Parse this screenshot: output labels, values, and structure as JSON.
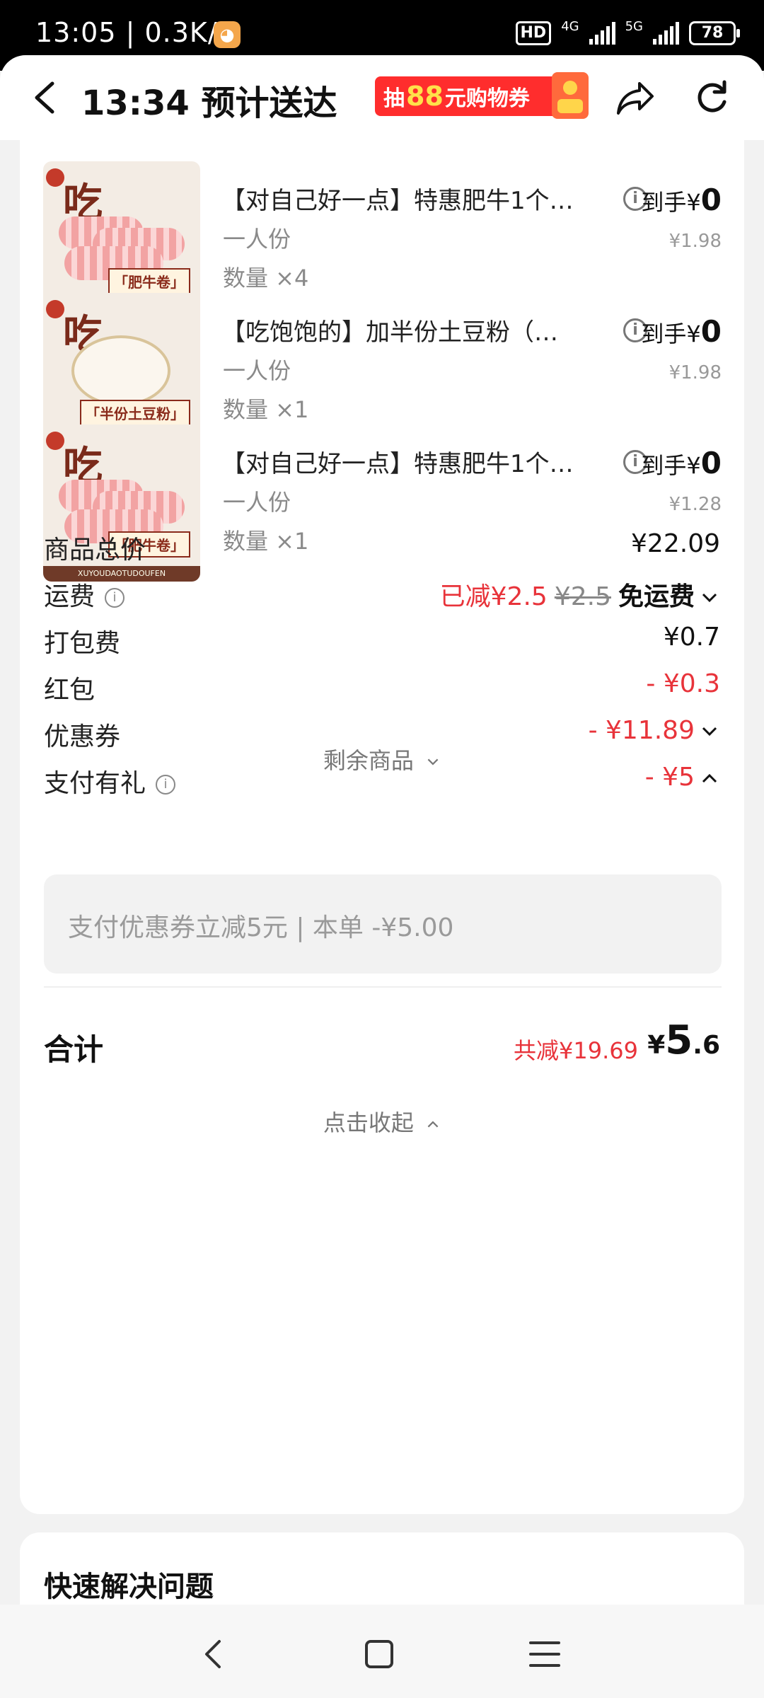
{
  "status": {
    "time_speed": "13:05 | 0.3K/s",
    "hd": "HD",
    "net1": "4G",
    "net2": "5G",
    "battery": "78"
  },
  "header": {
    "title": "13:34 预计送达",
    "promo_prefix": "抽",
    "promo_number": "88",
    "promo_suffix": "元购物券"
  },
  "items": [
    {
      "name": "【对自己好一点】特惠肥牛1个…",
      "spec": "一人份",
      "qty": "数量 ×4",
      "final_label": "到手¥",
      "final_value": "0",
      "orig": "¥1.98",
      "thumb_tag": "「肥牛卷」"
    },
    {
      "name": "【吃饱饱的】加半份土豆粉（…",
      "spec": "一人份",
      "qty": "数量 ×1",
      "final_label": "到手¥",
      "final_value": "0",
      "orig": "¥1.98",
      "thumb_tag": "「半份土豆粉」"
    },
    {
      "name": "【对自己好一点】特惠肥牛1个…",
      "spec": "一人份",
      "qty": "数量 ×1",
      "final_label": "到手¥",
      "final_value": "0",
      "orig": "¥1.28",
      "thumb_tag": "「肥牛卷」"
    }
  ],
  "more_items": "剩余商品",
  "rows": {
    "goods_total": {
      "label": "商品总价",
      "value": "¥22.09"
    },
    "shipping": {
      "label": "运费",
      "reduced": "已减¥2.5",
      "original": "¥2.5",
      "final": "免运费"
    },
    "packing": {
      "label": "打包费",
      "value": "¥0.7"
    },
    "redpacket": {
      "label": "红包",
      "value": "- ¥0.3"
    },
    "coupon": {
      "label": "优惠券",
      "value": "- ¥11.89"
    },
    "paygift": {
      "label": "支付有礼",
      "value": "- ¥5"
    }
  },
  "paygift_tip": "支付优惠券立减5元 | 本单 -¥5.00",
  "total": {
    "label": "合计",
    "saved": "共减¥19.69",
    "currency": "¥",
    "amount_big": "5",
    "amount_small": ".6"
  },
  "collapse": "点击收起",
  "section2_title": "快速解决问题",
  "colors": {
    "accent_red": "#e8333a",
    "promo_red": "#ff2d2d"
  }
}
